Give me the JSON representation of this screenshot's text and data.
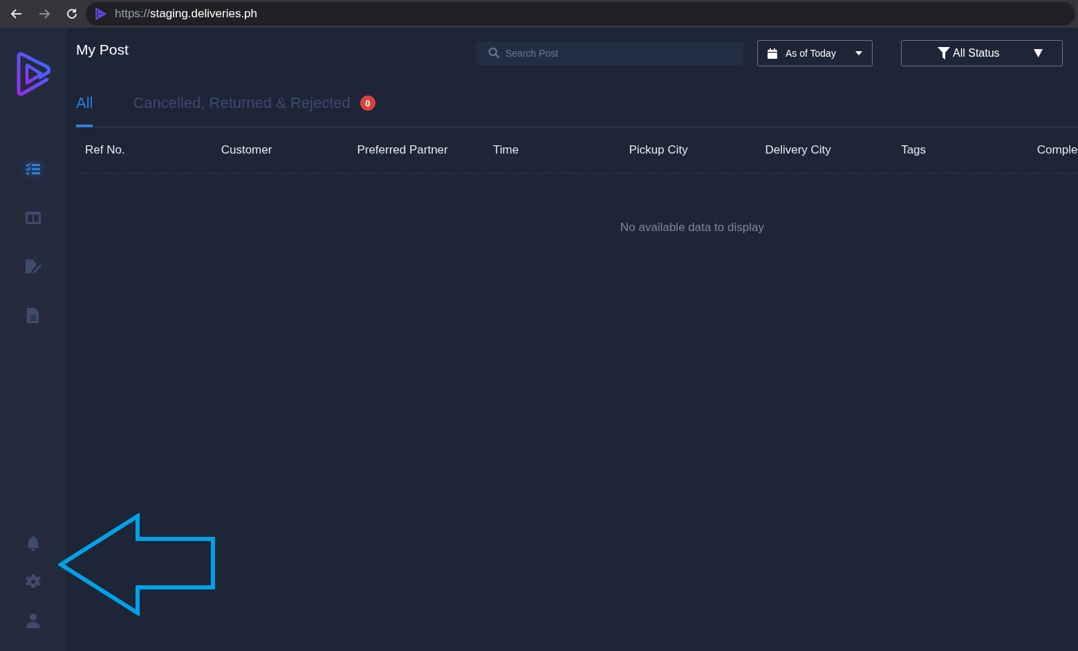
{
  "browser": {
    "url_scheme": "https://",
    "url_host": "staging.deliveries.ph"
  },
  "sidebar": {
    "items": [
      {
        "kind": "checklist",
        "selected": true
      },
      {
        "kind": "columns",
        "selected": false
      },
      {
        "kind": "signature",
        "selected": false
      },
      {
        "kind": "document",
        "selected": false
      }
    ],
    "bottom_items": [
      {
        "kind": "bell"
      },
      {
        "kind": "gear"
      },
      {
        "kind": "user"
      }
    ]
  },
  "page": {
    "title": "My Post"
  },
  "search": {
    "placeholder": "Search Post"
  },
  "date_filter": {
    "label": "As of Today"
  },
  "status_filter": {
    "label": "All Status"
  },
  "tabs": [
    {
      "label": "All",
      "selected": true
    },
    {
      "label": "Cancelled, Returned & Rejected",
      "selected": false,
      "badge": "0"
    }
  ],
  "table": {
    "columns": [
      "Ref No.",
      "Customer",
      "Preferred Partner",
      "Time",
      "Pickup City",
      "Delivery City",
      "Tags",
      "Comple"
    ],
    "empty_message": "No available data to display"
  },
  "annotation": {
    "kind": "arrow-left"
  }
}
